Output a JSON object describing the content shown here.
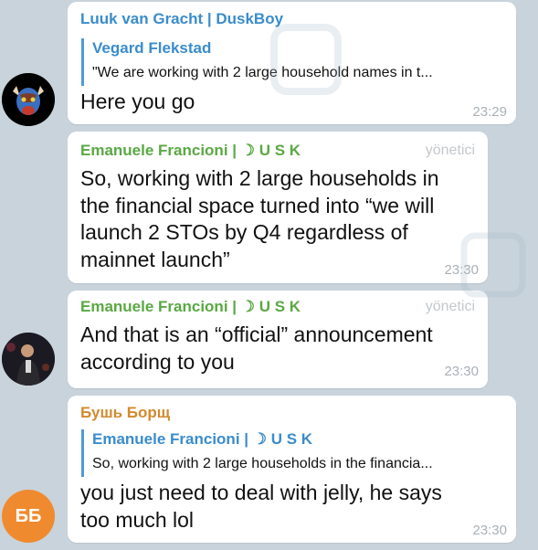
{
  "colors": {
    "chat_background": "#c9d3db",
    "bubble": "#ffffff",
    "sender_blue": "#3a8ccc",
    "sender_green": "#5aa843",
    "sender_orange": "#d28a2e",
    "badge_gray": "#c4c8cc",
    "time_gray": "#a9b0b6",
    "avatar_orange": "#f08a2e"
  },
  "messages": [
    {
      "sender": "Luuk van Gracht | DuskBoy",
      "reply": {
        "author": "Vegard Flekstad",
        "preview": "\"We are working with 2 large household names in t..."
      },
      "lines": [
        "Here you go"
      ],
      "time": "23:29",
      "avatar_icon": "bull-avatar-icon"
    },
    {
      "sender": "Emanuele Francioni | ☽ U S K",
      "badge": "yönetici",
      "lines": [
        "So, working with 2 large households in",
        "the financial space turned into “we will",
        "launch 2 STOs by Q4 regardless of",
        "mainnet launch”"
      ],
      "time": "23:30"
    },
    {
      "sender": "Emanuele Francioni | ☽ U S K",
      "badge": "yönetici",
      "lines": [
        "And that is an “official” announcement",
        "according to you"
      ],
      "time": "23:30",
      "avatar_icon": "person-photo-avatar-icon"
    },
    {
      "sender": "Бушь Борщ",
      "reply": {
        "author": "Emanuele Francioni | ☽ U S K",
        "preview": "So, working with 2 large households in the financia..."
      },
      "lines": [
        "you just need to deal with jelly, he says",
        "too much lol"
      ],
      "time": "23:30",
      "avatar_initials": "ББ"
    }
  ]
}
